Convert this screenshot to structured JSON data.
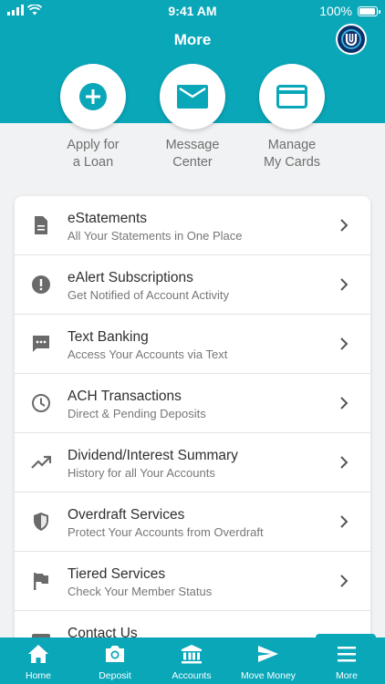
{
  "status": {
    "time": "9:41 AM",
    "battery": "100%",
    "battery_level": 1.0
  },
  "header": {
    "title": "More"
  },
  "quick_actions": [
    {
      "label": "Apply for\na Loan",
      "icon": "plus-icon"
    },
    {
      "label": "Message\nCenter",
      "icon": "mail-icon"
    },
    {
      "label": "Manage\nMy Cards",
      "icon": "card-icon"
    }
  ],
  "menu": [
    {
      "title": "eStatements",
      "subtitle": "All Your Statements in One Place",
      "icon": "document-icon"
    },
    {
      "title": "eAlert Subscriptions",
      "subtitle": "Get Notified of Account Activity",
      "icon": "alert-icon"
    },
    {
      "title": "Text Banking",
      "subtitle": "Access Your Accounts via Text",
      "icon": "chat-icon"
    },
    {
      "title": "ACH Transactions",
      "subtitle": "Direct & Pending Deposits",
      "icon": "clock-icon"
    },
    {
      "title": "Dividend/Interest Summary",
      "subtitle": "History for all Your Accounts",
      "icon": "trending-up-icon"
    },
    {
      "title": "Overdraft Services",
      "subtitle": "Protect Your Accounts from Overdraft",
      "icon": "shield-icon"
    },
    {
      "title": "Tiered Services",
      "subtitle": "Check Your Member Status",
      "icon": "flag-icon"
    },
    {
      "title": "Contact Us",
      "subtitle": "",
      "icon": "contact-icon"
    }
  ],
  "tabs": [
    {
      "label": "Home",
      "icon": "home-icon"
    },
    {
      "label": "Deposit",
      "icon": "camera-icon"
    },
    {
      "label": "Accounts",
      "icon": "bank-icon"
    },
    {
      "label": "Move Money",
      "icon": "send-icon"
    },
    {
      "label": "More",
      "icon": "menu-icon"
    }
  ],
  "colors": {
    "primary": "#0aa7b9",
    "logo": "#0c2f6b"
  }
}
